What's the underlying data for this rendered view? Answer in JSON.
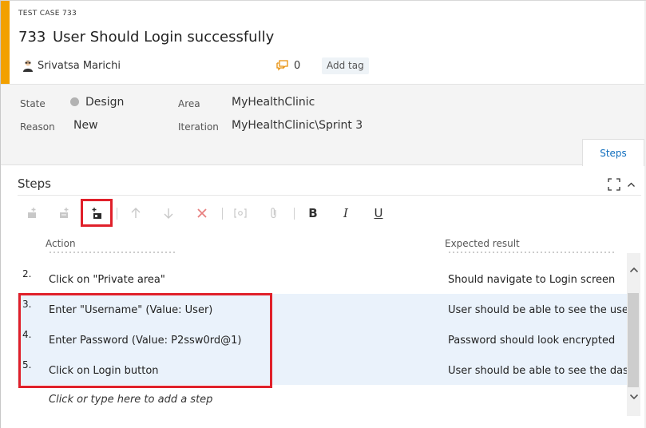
{
  "header": {
    "type_label": "TEST CASE 733",
    "id": "733",
    "title": "User Should Login successfully",
    "assignee": "Srivatsa Marichi",
    "comment_count": "0",
    "add_tag": "Add tag",
    "accent_color": "#f2a000"
  },
  "fields": {
    "state_label": "State",
    "state_value": "Design",
    "reason_label": "Reason",
    "reason_value": "New",
    "area_label": "Area",
    "area_value": "MyHealthClinic",
    "iteration_label": "Iteration",
    "iteration_value": "MyHealthClinic\\Sprint 3"
  },
  "tabs": {
    "steps": "Steps"
  },
  "steps": {
    "section_title": "Steps",
    "toolbar": {
      "bold": "B",
      "italic": "I",
      "underline": "U"
    },
    "columns": {
      "action": "Action",
      "expected": "Expected result"
    },
    "rows": [
      {
        "num": "2.",
        "action": "Click on \"Private area\"",
        "expected": "Should navigate to Login screen"
      },
      {
        "num": "3.",
        "action": "Enter \"Username\"  (Value: User)",
        "expected": "User should be able to see the usernam"
      },
      {
        "num": "4.",
        "action": "Enter Password  (Value: P2ssw0rd@1)",
        "expected": "Password should look encrypted"
      },
      {
        "num": "5.",
        "action": "Click on Login button",
        "expected": "User should be able to see the dashboa"
      }
    ],
    "add_step_placeholder": "Click or type here to add a step"
  }
}
